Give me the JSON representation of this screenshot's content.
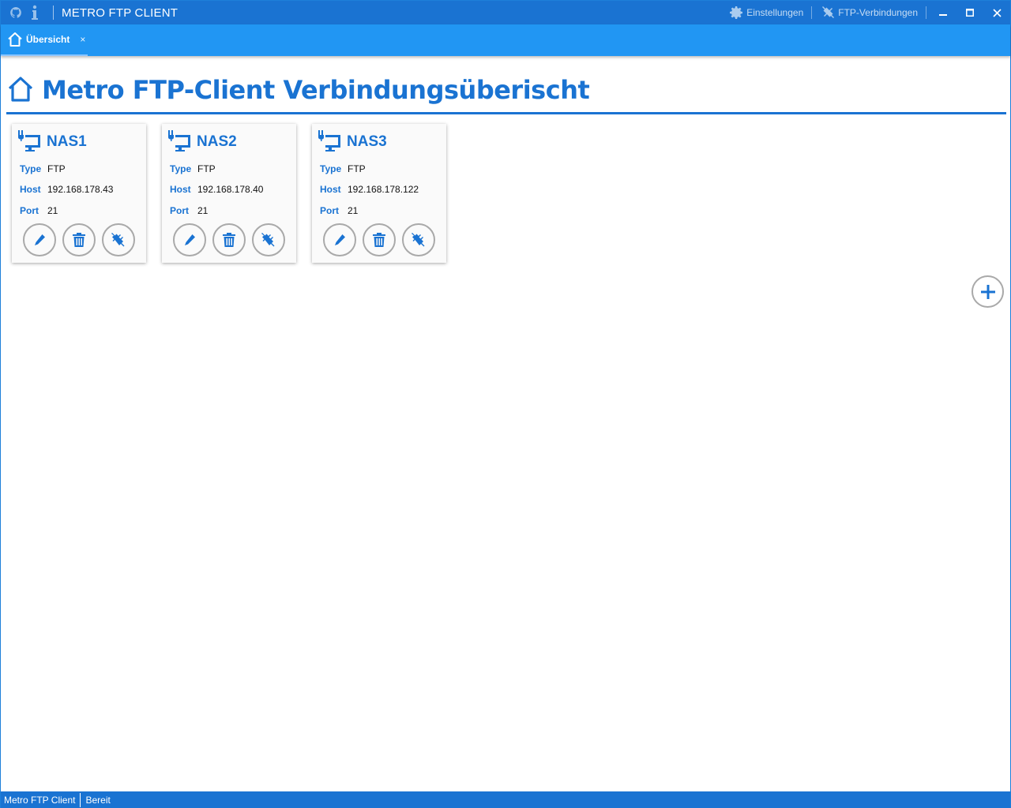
{
  "titlebar": {
    "app_title": "METRO FTP CLIENT",
    "settings_label": "Einstellungen",
    "connections_label": "FTP-Verbindungen"
  },
  "tabs": [
    {
      "label": "Übersicht",
      "close": "×"
    }
  ],
  "page": {
    "title": "Metro FTP-Client Verbindungsüberischt"
  },
  "connections": [
    {
      "name": "NAS1",
      "type_label": "Type",
      "type": "FTP",
      "host_label": "Host",
      "host": "192.168.178.43",
      "port_label": "Port",
      "port": "21"
    },
    {
      "name": "NAS2",
      "type_label": "Type",
      "type": "FTP",
      "host_label": "Host",
      "host": "192.168.178.40",
      "port_label": "Port",
      "port": "21"
    },
    {
      "name": "NAS3",
      "type_label": "Type",
      "type": "FTP",
      "host_label": "Host",
      "host": "192.168.178.122",
      "port_label": "Port",
      "port": "21"
    }
  ],
  "statusbar": {
    "app": "Metro FTP Client",
    "status": "Bereit"
  },
  "colors": {
    "accent": "#1a73d2",
    "tabstrip": "#2196f3"
  },
  "icons": {
    "titlebar": [
      "github-icon",
      "info-icon",
      "gear-icon",
      "plug-icon",
      "minimize-icon",
      "maximize-icon",
      "close-icon"
    ],
    "card": [
      "network-computer-icon",
      "pencil-icon",
      "trash-icon",
      "plug-connect-icon"
    ],
    "add": "plus-icon"
  }
}
